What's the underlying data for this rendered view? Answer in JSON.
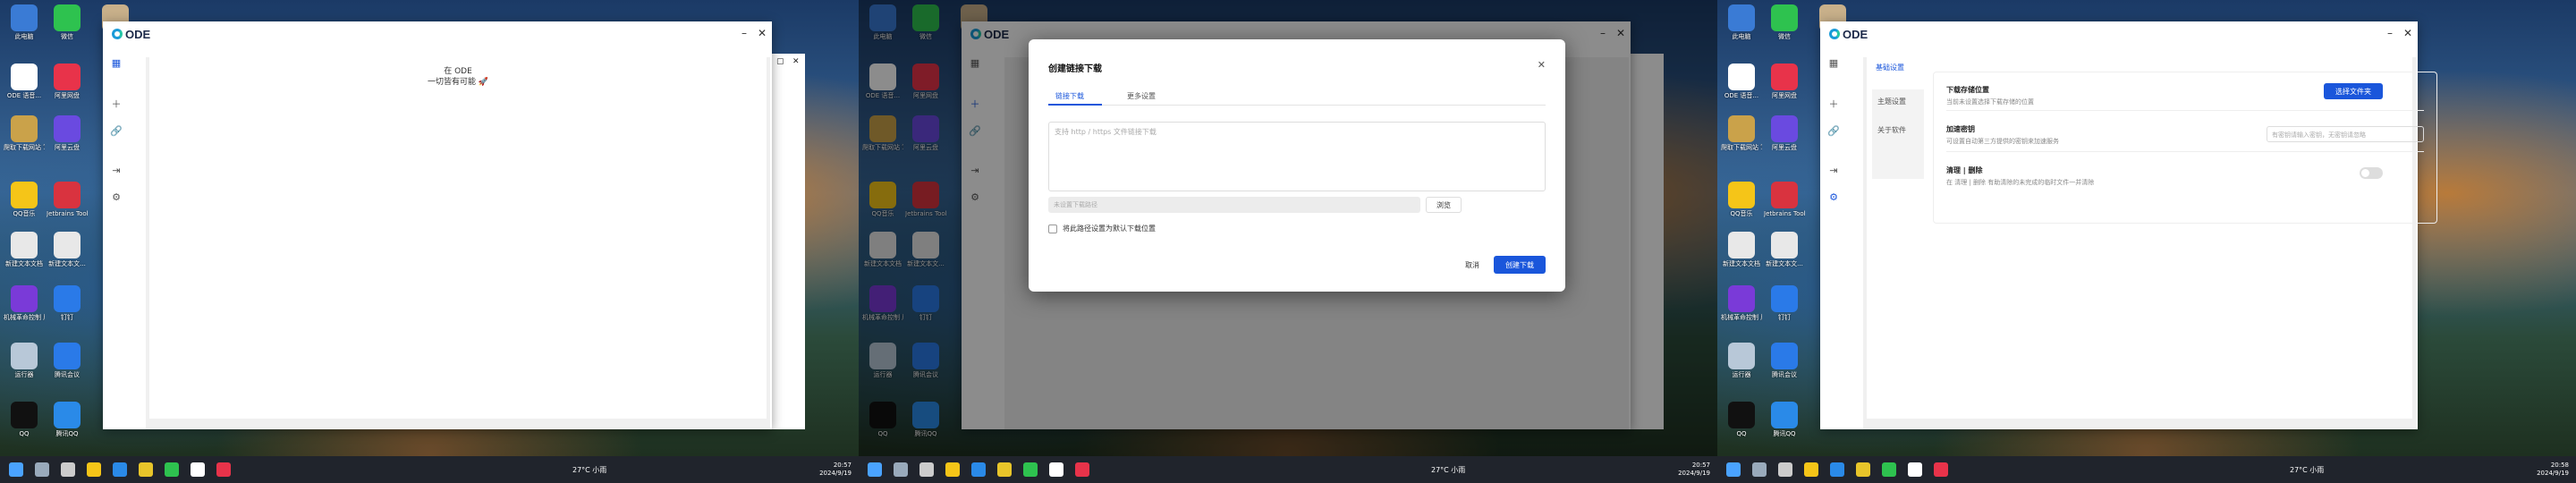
{
  "colors": {
    "accent": "#1a56db",
    "ode_blue": "#1a9bd8",
    "ode_green": "#26c6a6",
    "taskbar": "#20242c"
  },
  "desktop": {
    "icons": [
      {
        "label": "此电脑",
        "icon": "computer-icon",
        "color": "#3a7bd5"
      },
      {
        "label": "微信",
        "icon": "wechat-icon",
        "color": "#2ec24f"
      },
      {
        "label": "回收站",
        "icon": "recycle-bin-icon",
        "color": "#c8b08a"
      },
      {
        "label": "ODE 语音...",
        "icon": "ode-icon",
        "color": "#ffffff"
      },
      {
        "label": "阿里网盘",
        "icon": "aliyun-drive-icon",
        "color": "#e8334a"
      },
      {
        "label": "爬取下载网站\n写真 百日...",
        "icon": "folder-icon",
        "color": "#caa24a"
      },
      {
        "label": "阿里云盘",
        "icon": "cloud-icon",
        "color": "#6a4ae0"
      },
      {
        "label": "QQ音乐",
        "icon": "qq-music-icon",
        "color": "#f5c518"
      },
      {
        "label": "Jetbrains Tool...",
        "icon": "jetbrains-icon",
        "color": "#d9333f"
      },
      {
        "label": "新建文本文档",
        "icon": "text-file-icon",
        "color": "#e8e8e8"
      },
      {
        "label": "新建文本文...",
        "icon": "text-file-icon",
        "color": "#e8e8e8"
      },
      {
        "label": "机械革命控制\n服务中心",
        "icon": "control-center-icon",
        "color": "#7a3ad8"
      },
      {
        "label": "钉钉",
        "icon": "dingtalk-icon",
        "color": "#2a7ae8"
      },
      {
        "label": "运行器",
        "icon": "runner-icon",
        "color": "#b8c8d8"
      },
      {
        "label": "腾讯会议",
        "icon": "tencent-meeting-icon",
        "color": "#2a7ae8"
      },
      {
        "label": "QQ",
        "icon": "qq-icon",
        "color": "#111111"
      },
      {
        "label": "腾讯QQ",
        "icon": "tencent-icon",
        "color": "#2a8ae8"
      }
    ]
  },
  "taskbar": {
    "weather": "27°C 小雨",
    "time": "20:57",
    "date": "2024/9/19",
    "time3": "20:58",
    "icons": [
      "windows-icon",
      "search-icon",
      "taskview-icon",
      "explorer-icon",
      "edge-icon",
      "chrome-icon",
      "wechat-icon",
      "ode-taskbar-icon",
      "wps-icon"
    ]
  },
  "screen1": {
    "app": "ODE",
    "tagline1": "在 ODE",
    "tagline2": "一切皆有可能 🚀"
  },
  "screen2": {
    "app": "ODE",
    "dialog_title": "创建链接下载",
    "tabs": [
      "链接下载",
      "更多设置"
    ],
    "url_placeholder": "支持 http / https 文件链接下载",
    "path_placeholder": "未设置下载路径",
    "browse": "浏览",
    "checkbox_label": "将此路径设置为默认下载位置",
    "cancel": "取消",
    "create": "创建下载"
  },
  "screen3": {
    "app": "ODE",
    "nav": [
      "基础设置",
      "主题设置",
      "关于软件"
    ],
    "rows": [
      {
        "title": "下载存储位置",
        "desc": "当前未设置选择下载存储的位置",
        "action": "选择文件夹"
      },
      {
        "title": "加速密钥",
        "desc": "可设置自动第三方提供的密钥来加速服务",
        "placeholder": "有密钥请输入密钥，无密钥请忽略"
      },
      {
        "title": "清理 | 删除",
        "desc": "在 清理 | 删除 有助清除的未完成的临时文件一并清除"
      }
    ]
  }
}
